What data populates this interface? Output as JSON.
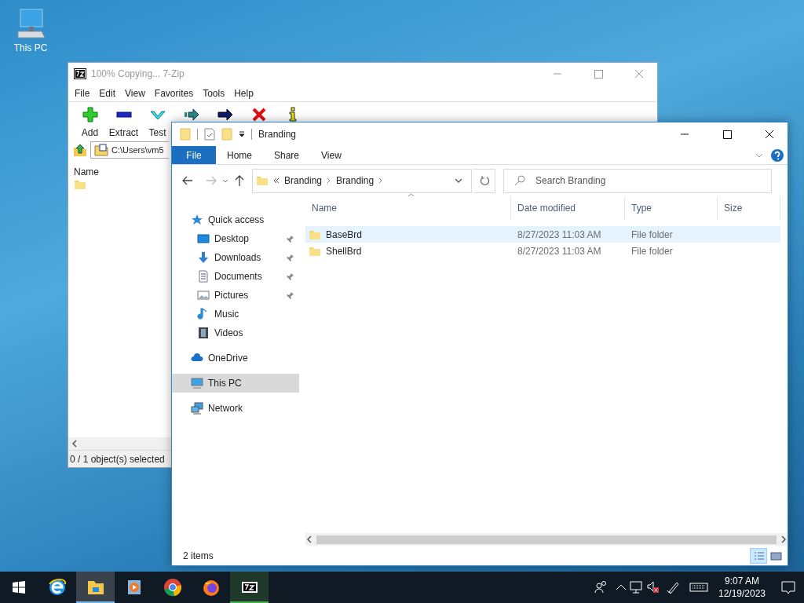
{
  "desktop_icons": [
    {
      "label": "This PC"
    }
  ],
  "sevenzip_window": {
    "title": "100% Copying... 7-Zip",
    "menu": [
      "File",
      "Edit",
      "View",
      "Favorites",
      "Tools",
      "Help"
    ],
    "toolbar": [
      {
        "kind": "add",
        "label": "Add"
      },
      {
        "kind": "extract",
        "label": "Extract"
      },
      {
        "kind": "test",
        "label": "Test"
      },
      {
        "kind": "copy"
      },
      {
        "kind": "move"
      },
      {
        "kind": "delete"
      },
      {
        "kind": "info"
      }
    ],
    "address": "C:\\Users\\vm5",
    "columns": [
      "Name"
    ],
    "status_bar": "0 / 1 object(s) selected"
  },
  "explorer_window": {
    "title": "Branding",
    "ribbon_tabs": [
      {
        "label": "File",
        "selected": true
      },
      {
        "label": "Home",
        "selected": false
      },
      {
        "label": "Share",
        "selected": false
      },
      {
        "label": "View",
        "selected": false
      }
    ],
    "breadcrumb": [
      "Branding",
      "Branding"
    ],
    "search": {
      "placeholder": "Search Branding"
    },
    "nav": [
      {
        "label": "Quick access",
        "selected": false,
        "children": [
          {
            "label": "Desktop",
            "pinned": true
          },
          {
            "label": "Downloads",
            "pinned": true
          },
          {
            "label": "Documents",
            "pinned": true
          },
          {
            "label": "Pictures",
            "pinned": true
          },
          {
            "label": "Music",
            "pinned": false
          },
          {
            "label": "Videos",
            "pinned": false
          }
        ]
      },
      {
        "label": "OneDrive",
        "selected": false
      },
      {
        "label": "This PC",
        "selected": true
      },
      {
        "label": "Network",
        "selected": false
      }
    ],
    "columns": [
      "Name",
      "Date modified",
      "Type",
      "Size"
    ],
    "rows": [
      {
        "name": "BaseBrd",
        "date": "8/27/2023 11:03 AM",
        "type": "File folder",
        "hovered": true
      },
      {
        "name": "ShellBrd",
        "date": "8/27/2023 11:03 AM",
        "type": "File folder",
        "hovered": false
      }
    ],
    "status_bar": "2 items",
    "views": [
      {
        "selected": true
      },
      {
        "selected": false
      }
    ]
  },
  "taskbar": {
    "apps": [
      {
        "active": false,
        "running": false
      },
      {
        "active": true,
        "running": true
      },
      {
        "active": false,
        "running": false
      },
      {
        "active": false,
        "running": false
      },
      {
        "active": false,
        "running": false
      },
      {
        "active": false,
        "running": true
      }
    ],
    "time": "9:07 AM",
    "date": "12/19/2023"
  }
}
